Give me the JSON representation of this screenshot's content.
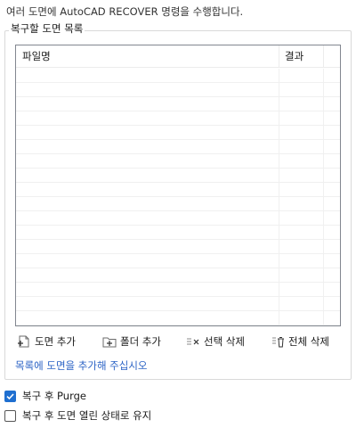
{
  "instruction": "여러 도면에 AutoCAD RECOVER 명령을 수행합니다.",
  "group": {
    "label": "복구할 도면 목록"
  },
  "file_list": {
    "columns": [
      "파일명",
      "결과",
      ""
    ],
    "rows": []
  },
  "toolbar": {
    "add_drawing": "도면 추가",
    "add_folder": "폴더 추가",
    "remove_selected": "선택 삭제",
    "remove_all": "전체 삭제"
  },
  "hint_link": "목록에 도면을 추가해 주십시오",
  "options": {
    "purge": {
      "label": "복구 후 Purge",
      "checked": true
    },
    "keep_open": {
      "label": "복구 후 도면 열린 상태로 유지",
      "checked": false
    }
  },
  "colors": {
    "accent": "#1f6fd0",
    "link": "#2b63c5",
    "list_border": "#828790"
  }
}
